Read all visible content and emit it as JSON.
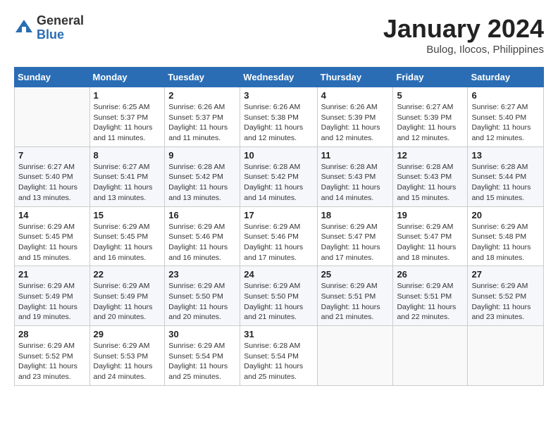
{
  "logo": {
    "general": "General",
    "blue": "Blue"
  },
  "title": "January 2024",
  "location": "Bulog, Ilocos, Philippines",
  "weekdays": [
    "Sunday",
    "Monday",
    "Tuesday",
    "Wednesday",
    "Thursday",
    "Friday",
    "Saturday"
  ],
  "weeks": [
    [
      {
        "day": "",
        "info": ""
      },
      {
        "day": "1",
        "info": "Sunrise: 6:25 AM\nSunset: 5:37 PM\nDaylight: 11 hours\nand 11 minutes."
      },
      {
        "day": "2",
        "info": "Sunrise: 6:26 AM\nSunset: 5:37 PM\nDaylight: 11 hours\nand 11 minutes."
      },
      {
        "day": "3",
        "info": "Sunrise: 6:26 AM\nSunset: 5:38 PM\nDaylight: 11 hours\nand 12 minutes."
      },
      {
        "day": "4",
        "info": "Sunrise: 6:26 AM\nSunset: 5:39 PM\nDaylight: 11 hours\nand 12 minutes."
      },
      {
        "day": "5",
        "info": "Sunrise: 6:27 AM\nSunset: 5:39 PM\nDaylight: 11 hours\nand 12 minutes."
      },
      {
        "day": "6",
        "info": "Sunrise: 6:27 AM\nSunset: 5:40 PM\nDaylight: 11 hours\nand 12 minutes."
      }
    ],
    [
      {
        "day": "7",
        "info": "Sunrise: 6:27 AM\nSunset: 5:40 PM\nDaylight: 11 hours\nand 13 minutes."
      },
      {
        "day": "8",
        "info": "Sunrise: 6:27 AM\nSunset: 5:41 PM\nDaylight: 11 hours\nand 13 minutes."
      },
      {
        "day": "9",
        "info": "Sunrise: 6:28 AM\nSunset: 5:42 PM\nDaylight: 11 hours\nand 13 minutes."
      },
      {
        "day": "10",
        "info": "Sunrise: 6:28 AM\nSunset: 5:42 PM\nDaylight: 11 hours\nand 14 minutes."
      },
      {
        "day": "11",
        "info": "Sunrise: 6:28 AM\nSunset: 5:43 PM\nDaylight: 11 hours\nand 14 minutes."
      },
      {
        "day": "12",
        "info": "Sunrise: 6:28 AM\nSunset: 5:43 PM\nDaylight: 11 hours\nand 15 minutes."
      },
      {
        "day": "13",
        "info": "Sunrise: 6:28 AM\nSunset: 5:44 PM\nDaylight: 11 hours\nand 15 minutes."
      }
    ],
    [
      {
        "day": "14",
        "info": "Sunrise: 6:29 AM\nSunset: 5:45 PM\nDaylight: 11 hours\nand 15 minutes."
      },
      {
        "day": "15",
        "info": "Sunrise: 6:29 AM\nSunset: 5:45 PM\nDaylight: 11 hours\nand 16 minutes."
      },
      {
        "day": "16",
        "info": "Sunrise: 6:29 AM\nSunset: 5:46 PM\nDaylight: 11 hours\nand 16 minutes."
      },
      {
        "day": "17",
        "info": "Sunrise: 6:29 AM\nSunset: 5:46 PM\nDaylight: 11 hours\nand 17 minutes."
      },
      {
        "day": "18",
        "info": "Sunrise: 6:29 AM\nSunset: 5:47 PM\nDaylight: 11 hours\nand 17 minutes."
      },
      {
        "day": "19",
        "info": "Sunrise: 6:29 AM\nSunset: 5:47 PM\nDaylight: 11 hours\nand 18 minutes."
      },
      {
        "day": "20",
        "info": "Sunrise: 6:29 AM\nSunset: 5:48 PM\nDaylight: 11 hours\nand 18 minutes."
      }
    ],
    [
      {
        "day": "21",
        "info": "Sunrise: 6:29 AM\nSunset: 5:49 PM\nDaylight: 11 hours\nand 19 minutes."
      },
      {
        "day": "22",
        "info": "Sunrise: 6:29 AM\nSunset: 5:49 PM\nDaylight: 11 hours\nand 20 minutes."
      },
      {
        "day": "23",
        "info": "Sunrise: 6:29 AM\nSunset: 5:50 PM\nDaylight: 11 hours\nand 20 minutes."
      },
      {
        "day": "24",
        "info": "Sunrise: 6:29 AM\nSunset: 5:50 PM\nDaylight: 11 hours\nand 21 minutes."
      },
      {
        "day": "25",
        "info": "Sunrise: 6:29 AM\nSunset: 5:51 PM\nDaylight: 11 hours\nand 21 minutes."
      },
      {
        "day": "26",
        "info": "Sunrise: 6:29 AM\nSunset: 5:51 PM\nDaylight: 11 hours\nand 22 minutes."
      },
      {
        "day": "27",
        "info": "Sunrise: 6:29 AM\nSunset: 5:52 PM\nDaylight: 11 hours\nand 23 minutes."
      }
    ],
    [
      {
        "day": "28",
        "info": "Sunrise: 6:29 AM\nSunset: 5:52 PM\nDaylight: 11 hours\nand 23 minutes."
      },
      {
        "day": "29",
        "info": "Sunrise: 6:29 AM\nSunset: 5:53 PM\nDaylight: 11 hours\nand 24 minutes."
      },
      {
        "day": "30",
        "info": "Sunrise: 6:29 AM\nSunset: 5:54 PM\nDaylight: 11 hours\nand 25 minutes."
      },
      {
        "day": "31",
        "info": "Sunrise: 6:28 AM\nSunset: 5:54 PM\nDaylight: 11 hours\nand 25 minutes."
      },
      {
        "day": "",
        "info": ""
      },
      {
        "day": "",
        "info": ""
      },
      {
        "day": "",
        "info": ""
      }
    ]
  ]
}
